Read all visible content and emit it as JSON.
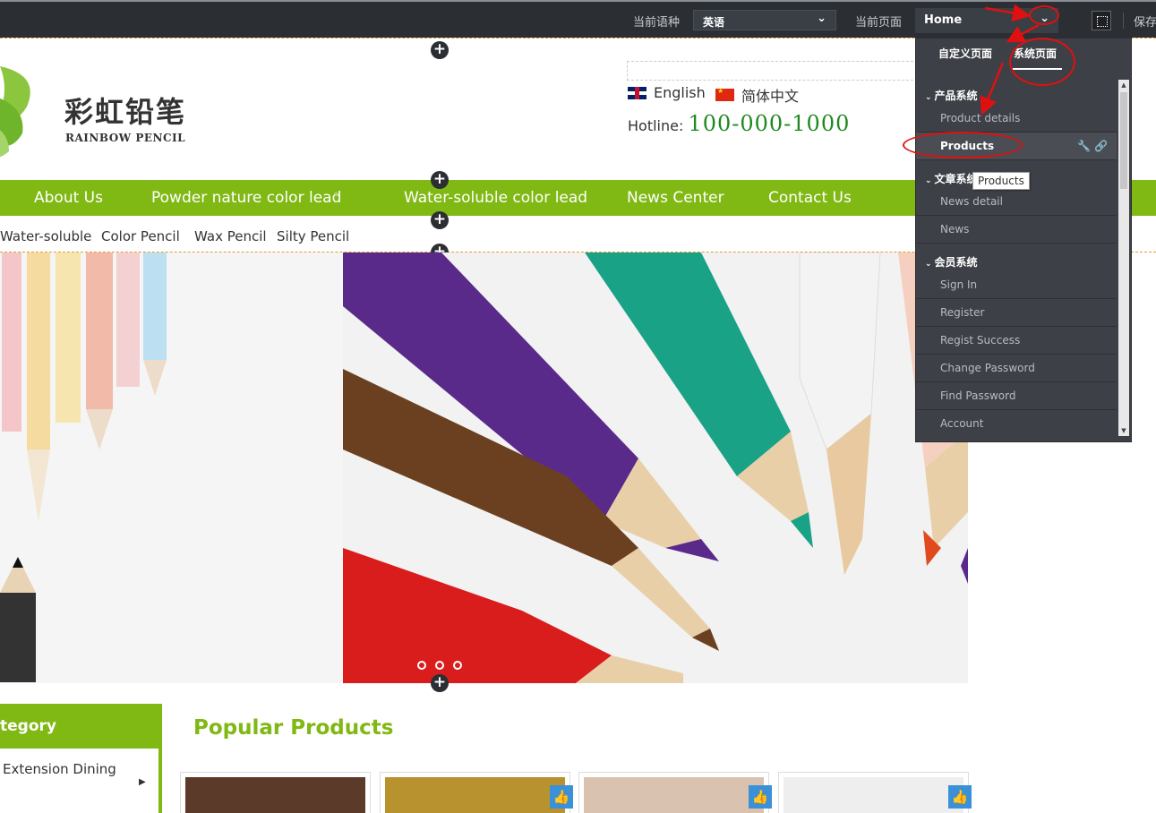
{
  "toolbar": {
    "lang_label": "当前语种",
    "lang_value": "英语",
    "page_label": "当前页面",
    "page_value": "Home",
    "save_label": "保存"
  },
  "header": {
    "logo_cn": "彩虹铅笔",
    "logo_en": "RAINBOW PENCIL",
    "lang_english": "English",
    "lang_chinese": "简体中文",
    "hotline_label": "Hotline:",
    "hotline_number": "100-000-1000"
  },
  "nav": {
    "items": [
      "About Us",
      "Powder nature color lead",
      "Water-soluble color lead",
      "News Center",
      "Contact Us"
    ]
  },
  "subnav": {
    "items": [
      "Water-soluble",
      "Color Pencil",
      "Wax Pencil",
      "Silty Pencil"
    ]
  },
  "sidebar": {
    "category_title": "tegory",
    "first_item": "Extension Dining"
  },
  "main": {
    "popular_title": "Popular Products"
  },
  "page_panel": {
    "tabs": [
      "自定义页面",
      "系统页面"
    ],
    "groups": [
      {
        "title": "产品系统",
        "items": [
          "Product details",
          "Products"
        ]
      },
      {
        "title": "文章系统",
        "items": [
          "News detail",
          "News"
        ]
      },
      {
        "title": "会员系统",
        "items": [
          "Sign In",
          "Register",
          "Regist Success",
          "Change Password",
          "Find Password",
          "Account"
        ]
      }
    ],
    "active_item": "Products",
    "tooltip": "Products"
  },
  "colors": {
    "accent_green": "#80b814",
    "toolbar_bg": "#2b2e33",
    "panel_bg": "#3d4046",
    "annotation_red": "#e01010"
  }
}
